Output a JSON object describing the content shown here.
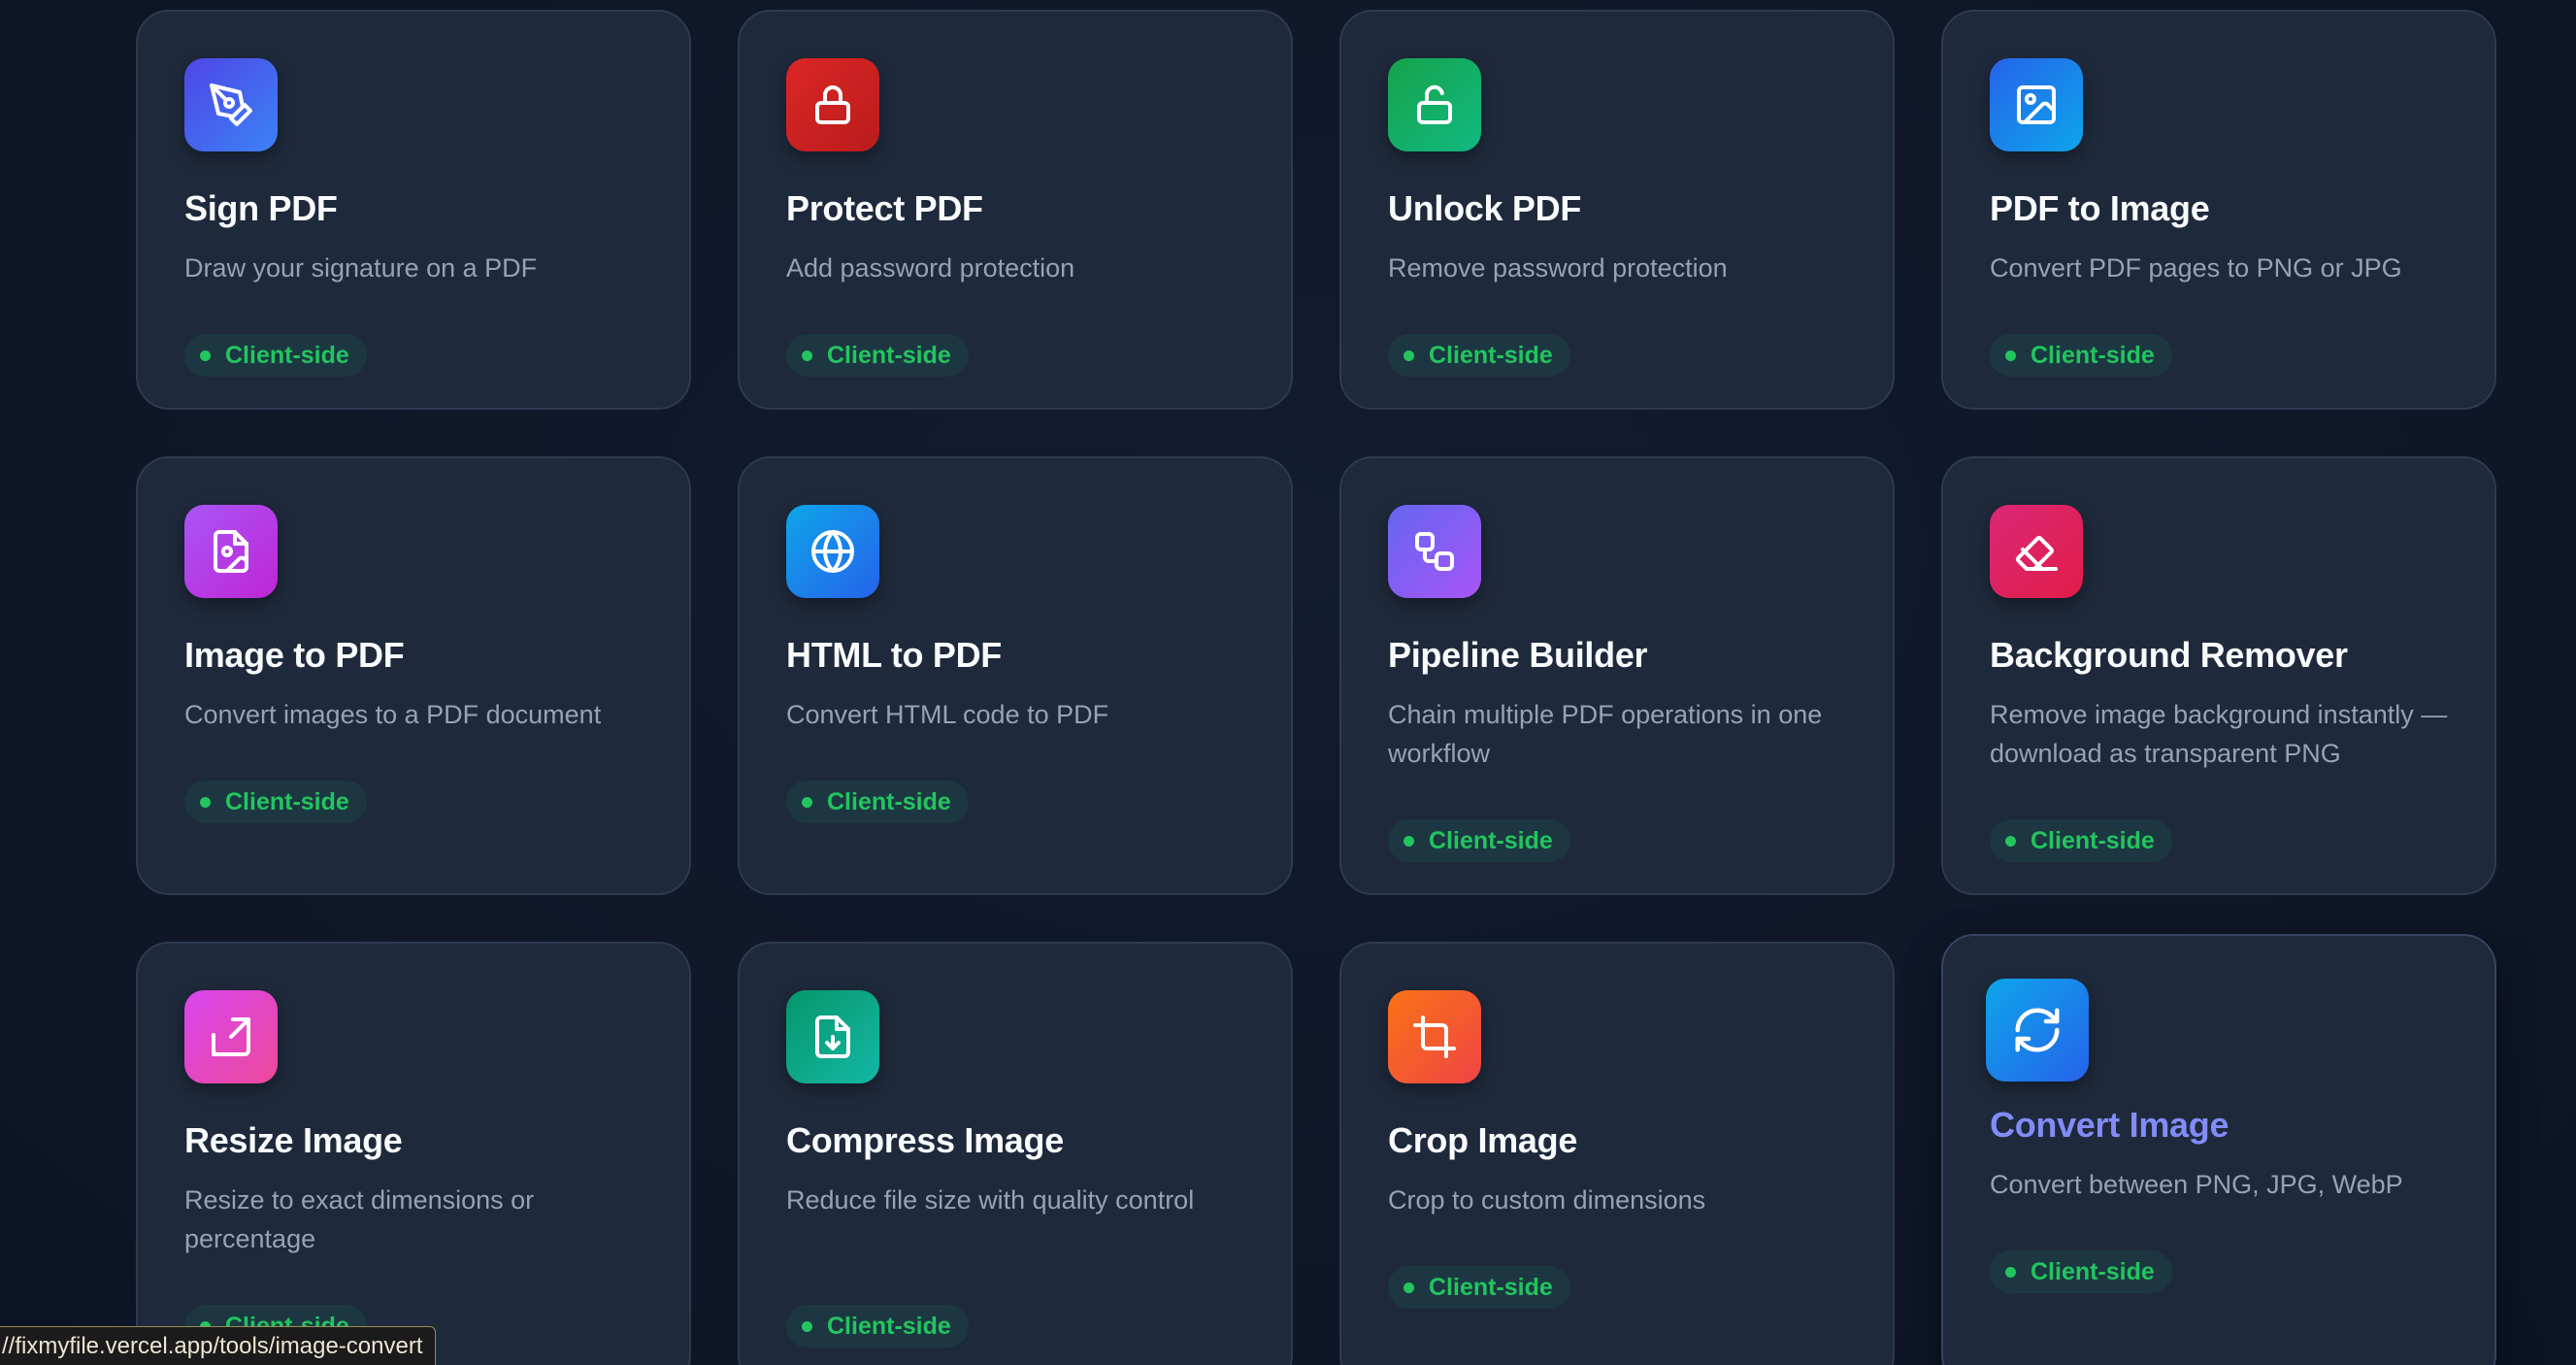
{
  "tools": [
    {
      "id": "sign-pdf",
      "title": "Sign PDF",
      "desc": "Draw your signature on a PDF",
      "badge": "Client-side",
      "icon": "pen-tool-icon",
      "grad": [
        "#4f46e5",
        "#3b82f6"
      ]
    },
    {
      "id": "protect-pdf",
      "title": "Protect PDF",
      "desc": "Add password protection",
      "badge": "Client-side",
      "icon": "lock-icon",
      "grad": [
        "#dc2626",
        "#b91c1c"
      ]
    },
    {
      "id": "unlock-pdf",
      "title": "Unlock PDF",
      "desc": "Remove password protection",
      "badge": "Client-side",
      "icon": "unlock-icon",
      "grad": [
        "#16a34a",
        "#10b981"
      ]
    },
    {
      "id": "pdf-to-image",
      "title": "PDF to Image",
      "desc": "Convert PDF pages to PNG or JPG",
      "badge": "Client-side",
      "icon": "image-icon",
      "grad": [
        "#2563eb",
        "#0ea5e9"
      ]
    },
    {
      "id": "image-to-pdf",
      "title": "Image to PDF",
      "desc": "Convert images to a PDF document",
      "badge": "Client-side",
      "icon": "file-image-icon",
      "grad": [
        "#a855f7",
        "#c026d3"
      ]
    },
    {
      "id": "html-to-pdf",
      "title": "HTML to PDF",
      "desc": "Convert HTML code to PDF",
      "badge": "Client-side",
      "icon": "globe-icon",
      "grad": [
        "#0ea5e9",
        "#2563eb"
      ]
    },
    {
      "id": "pipeline-builder",
      "title": "Pipeline Builder",
      "desc": "Chain multiple PDF operations in one workflow",
      "badge": "Client-side",
      "icon": "workflow-icon",
      "grad": [
        "#6366f1",
        "#a855f7"
      ]
    },
    {
      "id": "background-remover",
      "title": "Background Remover",
      "desc": "Remove image background instantly — download as transparent PNG",
      "badge": "Client-side",
      "icon": "eraser-icon",
      "grad": [
        "#db2777",
        "#e11d48"
      ]
    },
    {
      "id": "resize-image",
      "title": "Resize Image",
      "desc": "Resize to exact dimensions or percentage",
      "badge": "Client-side",
      "icon": "resize-icon",
      "grad": [
        "#d946ef",
        "#ec4899"
      ]
    },
    {
      "id": "compress-image",
      "title": "Compress Image",
      "desc": "Reduce file size with quality control",
      "badge": "Client-side",
      "icon": "file-download-icon",
      "grad": [
        "#059669",
        "#14b8a6"
      ]
    },
    {
      "id": "crop-image",
      "title": "Crop Image",
      "desc": "Crop to custom dimensions",
      "badge": "Client-side",
      "icon": "crop-icon",
      "grad": [
        "#f97316",
        "#ef4444"
      ]
    },
    {
      "id": "convert-image",
      "title": "Convert Image",
      "desc": "Convert between PNG, JPG, WebP",
      "badge": "Client-side",
      "icon": "refresh-icon",
      "grad": [
        "#0ea5e9",
        "#2563eb"
      ],
      "hovered": true
    }
  ],
  "status_bar": {
    "url": "//fixmyfile.vercel.app/tools/image-convert"
  }
}
